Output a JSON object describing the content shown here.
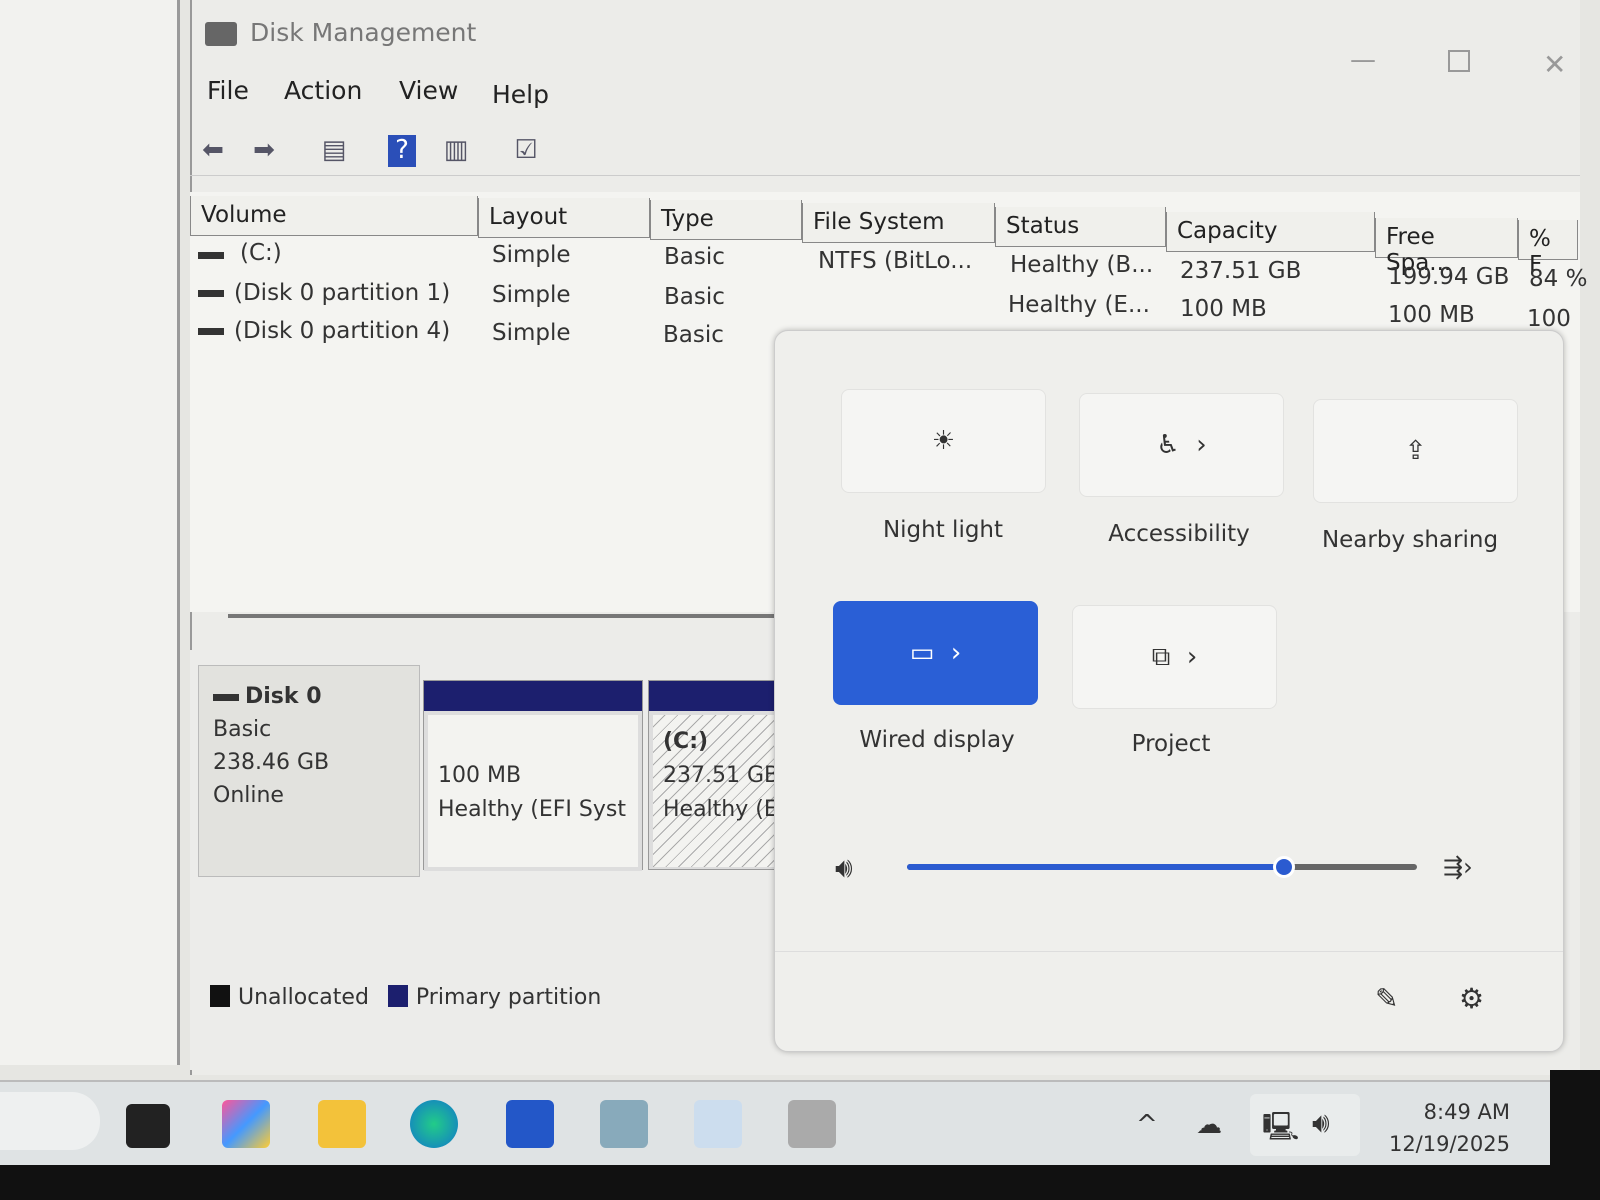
{
  "window": {
    "title": "Disk Management"
  },
  "menu": [
    "File",
    "Action",
    "View",
    "Help"
  ],
  "columns": [
    "Volume",
    "Layout",
    "Type",
    "File System",
    "Status",
    "Capacity",
    "Free Spa...",
    "% F"
  ],
  "rows": [
    {
      "volume": "(C:)",
      "layout": "Simple",
      "type": "Basic",
      "fs": "NTFS (BitLo...",
      "status": "Healthy (B...",
      "capacity": "237.51 GB",
      "free": "199.94 GB",
      "pct": "84 %"
    },
    {
      "volume": "(Disk 0 partition 1)",
      "layout": "Simple",
      "type": "Basic",
      "fs": "",
      "status": "Healthy (E...",
      "capacity": "100 MB",
      "free": "100 MB",
      "pct": "100"
    },
    {
      "volume": "(Disk 0 partition 4)",
      "layout": "Simple",
      "type": "Basic",
      "fs": "",
      "status": "",
      "capacity": "",
      "free": "",
      "pct": ""
    }
  ],
  "disk": {
    "name": "Disk 0",
    "type": "Basic",
    "size": "238.46 GB",
    "state": "Online",
    "partitions": [
      {
        "name": "",
        "size": "100 MB",
        "status": "Healthy (EFI Syst"
      },
      {
        "name": "(C:)",
        "size": "237.51 GB",
        "status": "Healthy (E"
      }
    ]
  },
  "legend": [
    {
      "label": "Unallocated",
      "color": "#111111"
    },
    {
      "label": "Primary partition",
      "color": "#1c1f6e"
    }
  ],
  "quick": {
    "night_light": "Night light",
    "accessibility": "Accessibility",
    "nearby": "Nearby sharing",
    "wired": "Wired display",
    "project": "Project"
  },
  "volume_percent": 74,
  "clock": {
    "time": "8:49 AM",
    "date": "12/19/2025"
  }
}
